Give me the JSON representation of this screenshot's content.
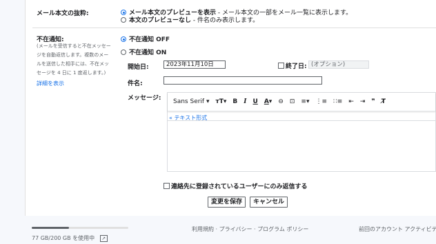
{
  "snippets": {
    "label": "メール本文の抜粋:",
    "option_show": "メール本文のプレビューを表示",
    "option_show_desc": " - メール本文の一部をメール一覧に表示します。",
    "option_hide": "本文のプレビューなし",
    "option_hide_desc": " - 件名のみ表示します。"
  },
  "vacation": {
    "label": "不在通知:",
    "desc_line1": "(メールを受信すると不在メッセー",
    "desc_line2": "ジを自動返信します。複数のメー",
    "desc_line3": "ルを送信した相手には、不在メッ",
    "desc_line4": "セージを 4 日に 1 度返します。)",
    "details_link": "詳細を表示",
    "off_label": "不在通知 OFF",
    "on_label": "不在通知 ON",
    "start_label": "開始日:",
    "start_value": "2023年11月10日",
    "end_label": "終了日:",
    "end_placeholder": "(オプション)",
    "subject_label": "件名:",
    "subject_value": "",
    "message_label": "メッセージ:",
    "plain_text_link": "« テキスト形式",
    "contacts_only_label": "連絡先に登録されているユーザーにのみ返信する"
  },
  "toolbar": {
    "font": "Sans Serif",
    "font_arrow": "▾",
    "size": "тT",
    "size_arrow": "▾",
    "bold": "B",
    "italic": "I",
    "underline": "U",
    "color": "A",
    "color_arrow": "▾",
    "link": "⊖",
    "image": "⊡",
    "align": "≡",
    "align_arrow": "▾",
    "numbered": "⋮≡",
    "bulleted": "∷≡",
    "indent_less": "⇤",
    "indent_more": "⇥",
    "quote": "❞",
    "clear": "T̸"
  },
  "actions": {
    "save": "変更を保存",
    "cancel": "キャンセル"
  },
  "footer": {
    "storage_text": "77 GB/200 GB を使用中",
    "storage_fraction": 0.385,
    "external_icon": "↗",
    "links": "利用規約 · プライバシー · プログラム ポリシー",
    "activity": "前回のアカウント アクティビティ"
  }
}
